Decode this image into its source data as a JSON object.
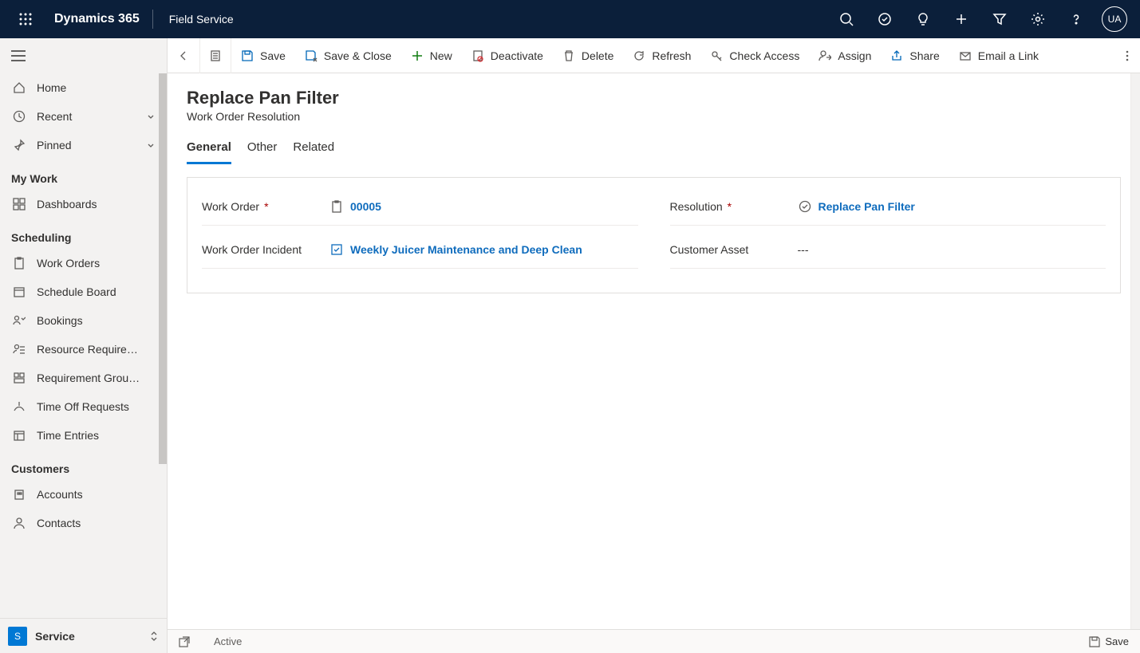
{
  "topbar": {
    "brand": "Dynamics 365",
    "app": "Field Service",
    "avatar": "UA"
  },
  "sidebar": {
    "home": "Home",
    "recent": "Recent",
    "pinned": "Pinned",
    "groups": [
      {
        "title": "My Work",
        "items": [
          {
            "label": "Dashboards",
            "icon": "dashboard"
          }
        ]
      },
      {
        "title": "Scheduling",
        "items": [
          {
            "label": "Work Orders",
            "icon": "workorder"
          },
          {
            "label": "Schedule Board",
            "icon": "calendar"
          },
          {
            "label": "Bookings",
            "icon": "bookings"
          },
          {
            "label": "Resource Require…",
            "icon": "resource"
          },
          {
            "label": "Requirement Grou…",
            "icon": "reqgroup"
          },
          {
            "label": "Time Off Requests",
            "icon": "timeoff"
          },
          {
            "label": "Time Entries",
            "icon": "timeentry"
          }
        ]
      },
      {
        "title": "Customers",
        "items": [
          {
            "label": "Accounts",
            "icon": "account"
          },
          {
            "label": "Contacts",
            "icon": "contact"
          }
        ]
      }
    ],
    "area": {
      "badge": "S",
      "label": "Service"
    }
  },
  "commands": {
    "save": "Save",
    "saveclose": "Save & Close",
    "new": "New",
    "deactivate": "Deactivate",
    "delete": "Delete",
    "refresh": "Refresh",
    "checkaccess": "Check Access",
    "assign": "Assign",
    "share": "Share",
    "emaillink": "Email a Link"
  },
  "form": {
    "title": "Replace Pan Filter",
    "subtitle": "Work Order Resolution",
    "tabs": {
      "general": "General",
      "other": "Other",
      "related": "Related"
    },
    "fields": {
      "workorder": {
        "label": "Work Order",
        "value": "00005"
      },
      "resolution": {
        "label": "Resolution",
        "value": "Replace Pan Filter"
      },
      "incident": {
        "label": "Work Order Incident",
        "value": "Weekly Juicer Maintenance and Deep Clean"
      },
      "asset": {
        "label": "Customer Asset",
        "value": "---"
      }
    }
  },
  "status": {
    "state": "Active",
    "save": "Save"
  }
}
